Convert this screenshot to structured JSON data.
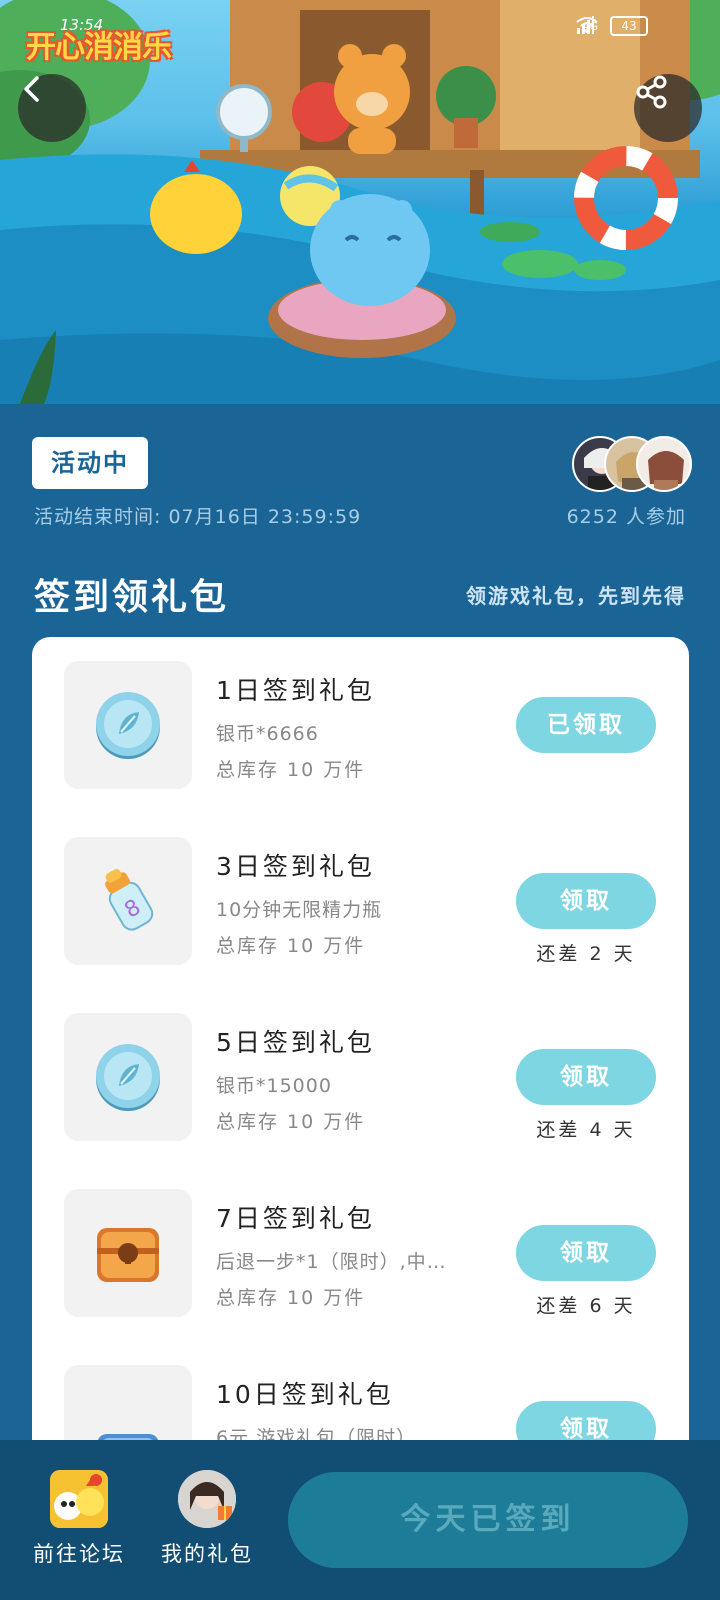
{
  "status_bar": {
    "time": "13:54",
    "network": "4G",
    "battery": "43"
  },
  "banner": {
    "game_name": "开心消消乐"
  },
  "activity": {
    "status": "活动中",
    "end_time": "活动结束时间: 07月16日 23:59:59",
    "participants": "6252 人参加"
  },
  "section": {
    "title": "签到领礼包",
    "subtitle": "领游戏礼包，先到先得"
  },
  "gifts": [
    {
      "name": "1日签到礼包",
      "desc": "银币*6666",
      "stock": "总库存 10 万件",
      "button": "已领取",
      "days_left": "",
      "icon": "silver-coin-icon"
    },
    {
      "name": "3日签到礼包",
      "desc": "10分钟无限精力瓶",
      "stock": "总库存 10 万件",
      "button": "领取",
      "days_left": "还差 2 天",
      "icon": "energy-bottle-icon"
    },
    {
      "name": "5日签到礼包",
      "desc": "银币*15000",
      "stock": "总库存 10 万件",
      "button": "领取",
      "days_left": "还差 4 天",
      "icon": "silver-coin-icon"
    },
    {
      "name": "7日签到礼包",
      "desc": "后退一步*1（限时）,中…",
      "stock": "总库存 10 万件",
      "button": "领取",
      "days_left": "还差 6 天",
      "icon": "treasure-chest-icon"
    },
    {
      "name": "10日签到礼包",
      "desc": "6元 游戏礼包（限时）",
      "stock": "",
      "button": "领取",
      "days_left": "",
      "icon": "blue-chest-icon"
    }
  ],
  "bottom_bar": {
    "forum_label": "前往论坛",
    "my_gifts_label": "我的礼包",
    "checkin_label": "今天已签到"
  },
  "colors": {
    "background": "#1a6496",
    "button_accent": "#7fd6e3",
    "bottom_bar": "#124d73"
  }
}
